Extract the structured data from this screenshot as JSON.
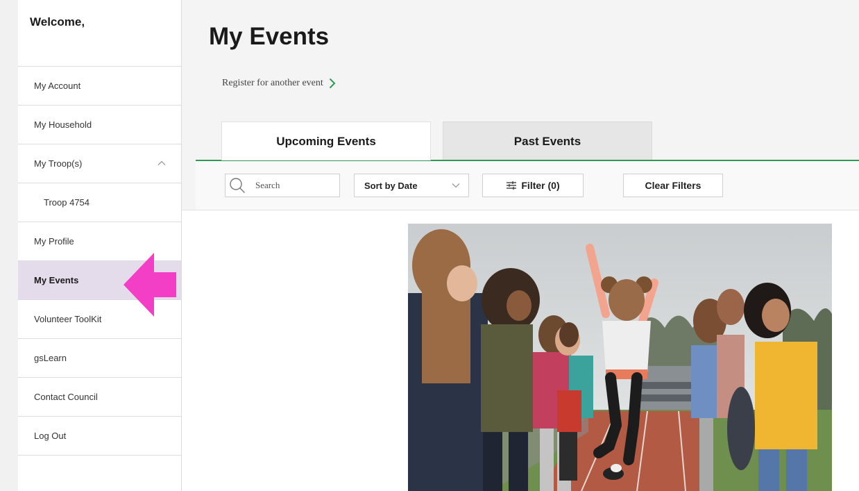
{
  "sidebar": {
    "welcome": "Welcome,",
    "items": [
      {
        "label": "My Account"
      },
      {
        "label": "My Household"
      },
      {
        "label": "My Troop(s)"
      },
      {
        "label": "Troop 4754"
      },
      {
        "label": "My Profile"
      },
      {
        "label": "My Events"
      },
      {
        "label": "Volunteer ToolKit"
      },
      {
        "label": "gsLearn"
      },
      {
        "label": "Contact Council"
      },
      {
        "label": "Log Out"
      }
    ]
  },
  "main": {
    "title": "My Events",
    "register_link": "Register for another event",
    "tabs": [
      {
        "label": "Upcoming Events",
        "selected": true
      },
      {
        "label": "Past Events",
        "selected": false
      }
    ],
    "filters": {
      "search_placeholder": "Search",
      "sort_label": "Sort by Date",
      "filter_label": "Filter (0)",
      "clear_label": "Clear Filters"
    }
  },
  "colors": {
    "accent_green": "#2e9a53",
    "highlight_arrow": "#f23fc6",
    "active_item_bg": "#e4dbeb"
  },
  "icons": {
    "register_chevron": "chevron-right-icon",
    "troop_toggle": "chevron-up-icon",
    "search": "search-icon",
    "sort_dropdown": "chevron-down-icon",
    "filter": "sliders-icon",
    "pointer": "arrow-left-icon"
  }
}
